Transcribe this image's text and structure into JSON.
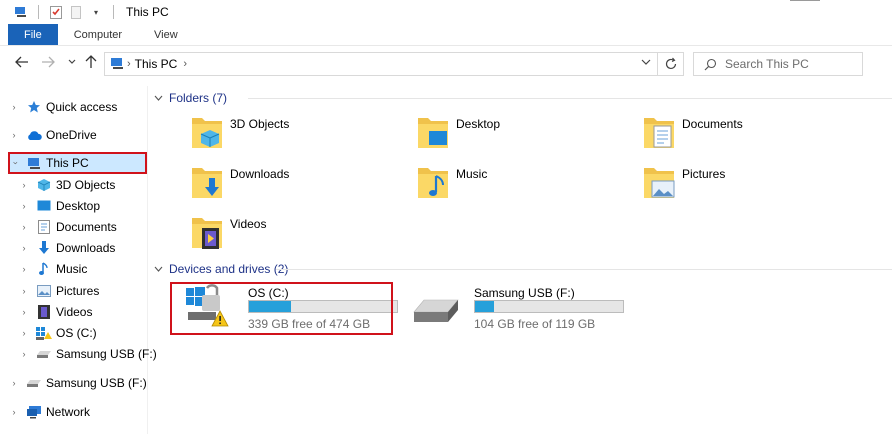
{
  "window": {
    "title": "This PC"
  },
  "ribbon": {
    "tabs": [
      "File",
      "Computer",
      "View"
    ]
  },
  "address": {
    "crumb": "This PC"
  },
  "search": {
    "placeholder": "Search This PC"
  },
  "sidebar": {
    "items": [
      {
        "label": "Quick access",
        "icon": "star-icon",
        "expanded": false
      },
      {
        "label": "OneDrive",
        "icon": "cloud-icon",
        "expanded": false
      },
      {
        "label": "This PC",
        "icon": "computer-icon",
        "expanded": true,
        "selected": true
      },
      {
        "label": "3D Objects",
        "icon": "cube-icon"
      },
      {
        "label": "Desktop",
        "icon": "desktop-icon"
      },
      {
        "label": "Documents",
        "icon": "document-icon"
      },
      {
        "label": "Downloads",
        "icon": "download-icon"
      },
      {
        "label": "Music",
        "icon": "music-icon"
      },
      {
        "label": "Pictures",
        "icon": "picture-icon"
      },
      {
        "label": "Videos",
        "icon": "video-icon"
      },
      {
        "label": "OS (C:)",
        "icon": "windows-drive-icon"
      },
      {
        "label": "Samsung USB (F:)",
        "icon": "usb-drive-icon"
      },
      {
        "label": "Samsung USB (F:)",
        "icon": "usb-drive-icon"
      },
      {
        "label": "Network",
        "icon": "network-icon"
      }
    ]
  },
  "folders": {
    "header": "Folders (7)",
    "items": [
      {
        "label": "3D Objects",
        "icon": "cube-folder-icon"
      },
      {
        "label": "Desktop",
        "icon": "desktop-folder-icon"
      },
      {
        "label": "Documents",
        "icon": "documents-folder-icon"
      },
      {
        "label": "Downloads",
        "icon": "downloads-folder-icon"
      },
      {
        "label": "Music",
        "icon": "music-folder-icon"
      },
      {
        "label": "Pictures",
        "icon": "pictures-folder-icon"
      },
      {
        "label": "Videos",
        "icon": "videos-folder-icon"
      }
    ]
  },
  "drives": {
    "header": "Devices and drives (2)",
    "items": [
      {
        "name": "OS (C:)",
        "free": "339 GB free of 474 GB",
        "used_fraction": 0.285,
        "icon": "windows-drive-warning-icon"
      },
      {
        "name": "Samsung USB (F:)",
        "free": "104 GB free of 119 GB",
        "used_fraction": 0.126,
        "icon": "usb-drive-icon"
      }
    ]
  },
  "colors": {
    "accent": "#1a63b8",
    "selection": "#cce8ff",
    "highlight_box": "#d0121b",
    "drive_fill": "#26a0da",
    "group_header": "#1e3287"
  }
}
